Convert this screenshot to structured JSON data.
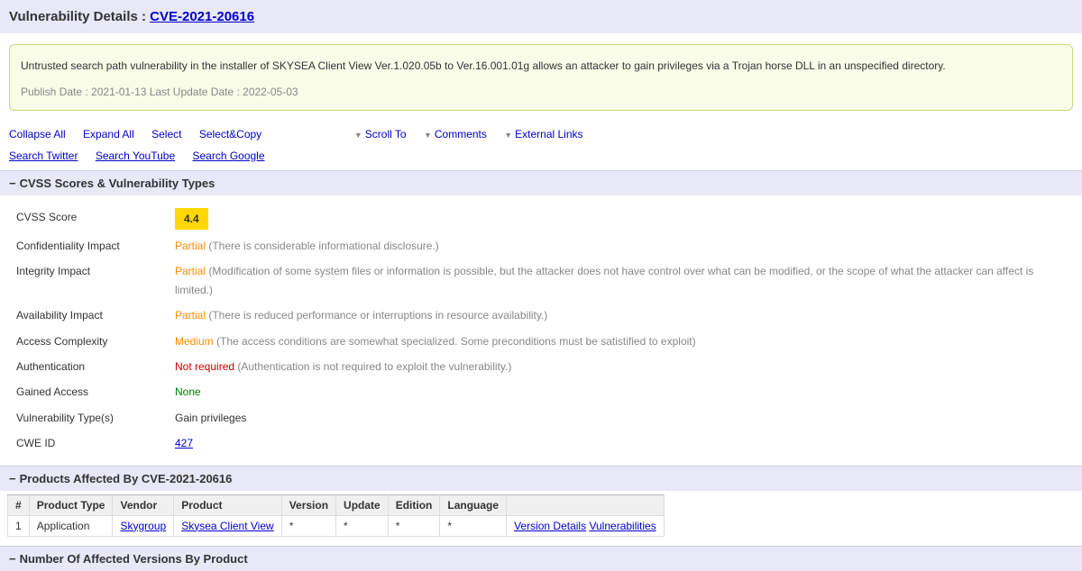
{
  "header": {
    "prefix": "Vulnerability Details : ",
    "cve": "CVE-2021-20616"
  },
  "description": {
    "text": "Untrusted search path vulnerability in the installer of SKYSEA Client View Ver.1.020.05b to Ver.16.001.01g allows an attacker to gain privileges via a Trojan horse DLL in an unspecified directory.",
    "publish": "Publish Date : 2021-01-13 Last Update Date : 2022-05-03"
  },
  "actions": {
    "collapse_all": "Collapse All",
    "expand_all": "Expand All",
    "select": "Select",
    "select_copy": "Select&Copy",
    "scroll_to": "Scroll To",
    "comments": "Comments",
    "external_links": "External Links",
    "search_twitter": "Search Twitter",
    "search_youtube": "Search YouTube",
    "search_google": "Search Google"
  },
  "sections": {
    "cvss_header": "CVSS Scores & Vulnerability Types",
    "products_header": "Products Affected By CVE-2021-20616",
    "versions_header": "Number Of Affected Versions By Product"
  },
  "cvss": {
    "score_label": "CVSS Score",
    "score_value": "4.4",
    "conf_label": "Confidentiality Impact",
    "conf_val": "Partial",
    "conf_desc": " (There is considerable informational disclosure.)",
    "int_label": "Integrity Impact",
    "int_val": "Partial",
    "int_desc": " (Modification of some system files or information is possible, but the attacker does not have control over what can be modified, or the scope of what the attacker can affect is limited.)",
    "avail_label": "Availability Impact",
    "avail_val": "Partial",
    "avail_desc": " (There is reduced performance or interruptions in resource availability.)",
    "acc_label": "Access Complexity",
    "acc_val": "Medium",
    "acc_desc": " (The access conditions are somewhat specialized. Some preconditions must be satistified to exploit)",
    "auth_label": "Authentication",
    "auth_val": "Not required",
    "auth_desc": " (Authentication is not required to exploit the vulnerability.)",
    "gained_label": "Gained Access",
    "gained_val": "None",
    "vtype_label": "Vulnerability Type(s)",
    "vtype_val": "Gain privileges",
    "cwe_label": "CWE ID",
    "cwe_val": "427"
  },
  "products_table": {
    "headers": {
      "num": "#",
      "ptype": "Product Type",
      "vendor": "Vendor",
      "product": "Product",
      "version": "Version",
      "update": "Update",
      "edition": "Edition",
      "language": "Language",
      "blank": ""
    },
    "rows": [
      {
        "num": "1",
        "ptype": "Application",
        "vendor": "Skygroup",
        "product": "Skysea Client View",
        "version": "*",
        "update": "*",
        "edition": "*",
        "language": "*",
        "link1": "Version Details",
        "link2": "Vulnerabilities"
      }
    ]
  }
}
